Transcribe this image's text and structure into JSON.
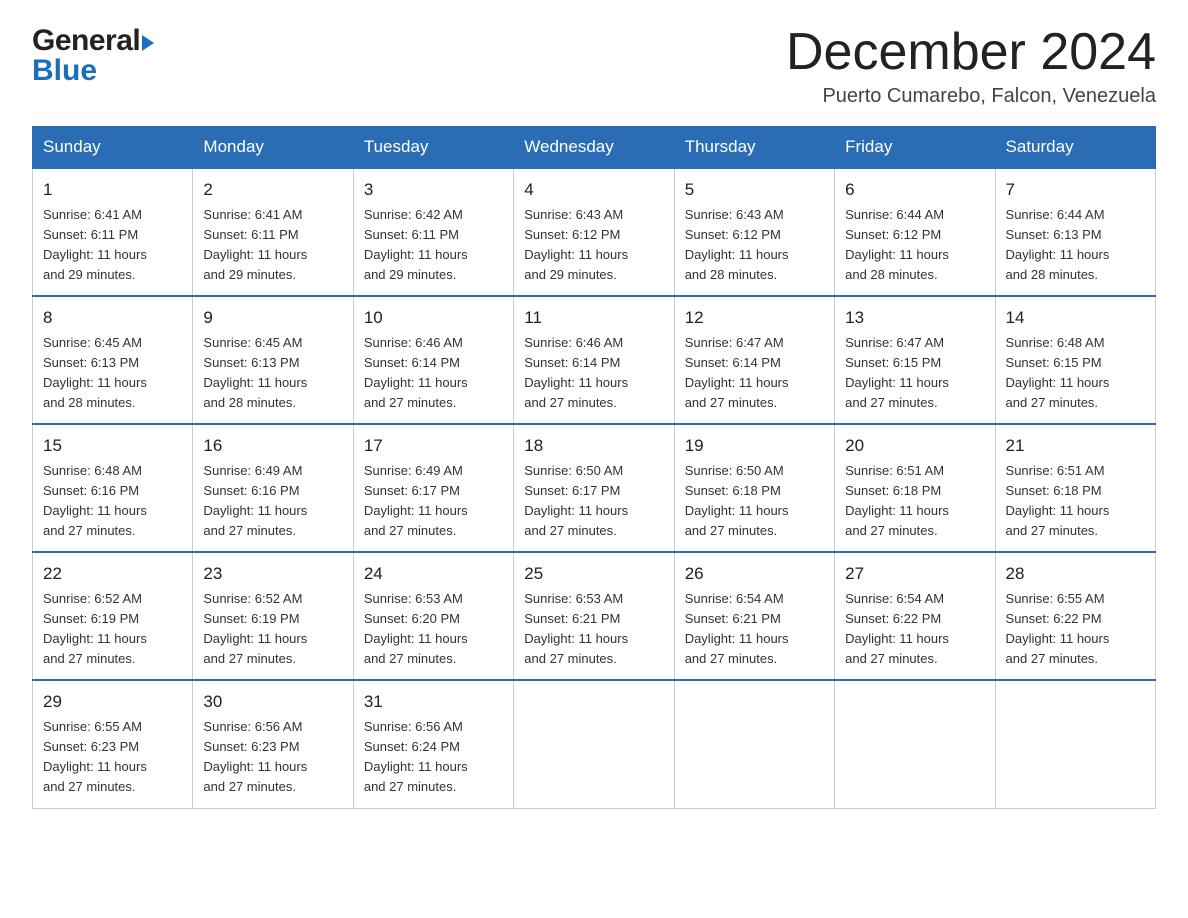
{
  "header": {
    "logo_general": "General",
    "logo_blue": "Blue",
    "month_title": "December 2024",
    "location": "Puerto Cumarebo, Falcon, Venezuela"
  },
  "weekdays": [
    "Sunday",
    "Monday",
    "Tuesday",
    "Wednesday",
    "Thursday",
    "Friday",
    "Saturday"
  ],
  "weeks": [
    [
      {
        "day": "1",
        "sunrise": "6:41 AM",
        "sunset": "6:11 PM",
        "daylight": "11 hours and 29 minutes."
      },
      {
        "day": "2",
        "sunrise": "6:41 AM",
        "sunset": "6:11 PM",
        "daylight": "11 hours and 29 minutes."
      },
      {
        "day": "3",
        "sunrise": "6:42 AM",
        "sunset": "6:11 PM",
        "daylight": "11 hours and 29 minutes."
      },
      {
        "day": "4",
        "sunrise": "6:43 AM",
        "sunset": "6:12 PM",
        "daylight": "11 hours and 29 minutes."
      },
      {
        "day": "5",
        "sunrise": "6:43 AM",
        "sunset": "6:12 PM",
        "daylight": "11 hours and 28 minutes."
      },
      {
        "day": "6",
        "sunrise": "6:44 AM",
        "sunset": "6:12 PM",
        "daylight": "11 hours and 28 minutes."
      },
      {
        "day": "7",
        "sunrise": "6:44 AM",
        "sunset": "6:13 PM",
        "daylight": "11 hours and 28 minutes."
      }
    ],
    [
      {
        "day": "8",
        "sunrise": "6:45 AM",
        "sunset": "6:13 PM",
        "daylight": "11 hours and 28 minutes."
      },
      {
        "day": "9",
        "sunrise": "6:45 AM",
        "sunset": "6:13 PM",
        "daylight": "11 hours and 28 minutes."
      },
      {
        "day": "10",
        "sunrise": "6:46 AM",
        "sunset": "6:14 PM",
        "daylight": "11 hours and 27 minutes."
      },
      {
        "day": "11",
        "sunrise": "6:46 AM",
        "sunset": "6:14 PM",
        "daylight": "11 hours and 27 minutes."
      },
      {
        "day": "12",
        "sunrise": "6:47 AM",
        "sunset": "6:14 PM",
        "daylight": "11 hours and 27 minutes."
      },
      {
        "day": "13",
        "sunrise": "6:47 AM",
        "sunset": "6:15 PM",
        "daylight": "11 hours and 27 minutes."
      },
      {
        "day": "14",
        "sunrise": "6:48 AM",
        "sunset": "6:15 PM",
        "daylight": "11 hours and 27 minutes."
      }
    ],
    [
      {
        "day": "15",
        "sunrise": "6:48 AM",
        "sunset": "6:16 PM",
        "daylight": "11 hours and 27 minutes."
      },
      {
        "day": "16",
        "sunrise": "6:49 AM",
        "sunset": "6:16 PM",
        "daylight": "11 hours and 27 minutes."
      },
      {
        "day": "17",
        "sunrise": "6:49 AM",
        "sunset": "6:17 PM",
        "daylight": "11 hours and 27 minutes."
      },
      {
        "day": "18",
        "sunrise": "6:50 AM",
        "sunset": "6:17 PM",
        "daylight": "11 hours and 27 minutes."
      },
      {
        "day": "19",
        "sunrise": "6:50 AM",
        "sunset": "6:18 PM",
        "daylight": "11 hours and 27 minutes."
      },
      {
        "day": "20",
        "sunrise": "6:51 AM",
        "sunset": "6:18 PM",
        "daylight": "11 hours and 27 minutes."
      },
      {
        "day": "21",
        "sunrise": "6:51 AM",
        "sunset": "6:18 PM",
        "daylight": "11 hours and 27 minutes."
      }
    ],
    [
      {
        "day": "22",
        "sunrise": "6:52 AM",
        "sunset": "6:19 PM",
        "daylight": "11 hours and 27 minutes."
      },
      {
        "day": "23",
        "sunrise": "6:52 AM",
        "sunset": "6:19 PM",
        "daylight": "11 hours and 27 minutes."
      },
      {
        "day": "24",
        "sunrise": "6:53 AM",
        "sunset": "6:20 PM",
        "daylight": "11 hours and 27 minutes."
      },
      {
        "day": "25",
        "sunrise": "6:53 AM",
        "sunset": "6:21 PM",
        "daylight": "11 hours and 27 minutes."
      },
      {
        "day": "26",
        "sunrise": "6:54 AM",
        "sunset": "6:21 PM",
        "daylight": "11 hours and 27 minutes."
      },
      {
        "day": "27",
        "sunrise": "6:54 AM",
        "sunset": "6:22 PM",
        "daylight": "11 hours and 27 minutes."
      },
      {
        "day": "28",
        "sunrise": "6:55 AM",
        "sunset": "6:22 PM",
        "daylight": "11 hours and 27 minutes."
      }
    ],
    [
      {
        "day": "29",
        "sunrise": "6:55 AM",
        "sunset": "6:23 PM",
        "daylight": "11 hours and 27 minutes."
      },
      {
        "day": "30",
        "sunrise": "6:56 AM",
        "sunset": "6:23 PM",
        "daylight": "11 hours and 27 minutes."
      },
      {
        "day": "31",
        "sunrise": "6:56 AM",
        "sunset": "6:24 PM",
        "daylight": "11 hours and 27 minutes."
      },
      null,
      null,
      null,
      null
    ]
  ],
  "labels": {
    "sunrise": "Sunrise:",
    "sunset": "Sunset:",
    "daylight": "Daylight:"
  }
}
